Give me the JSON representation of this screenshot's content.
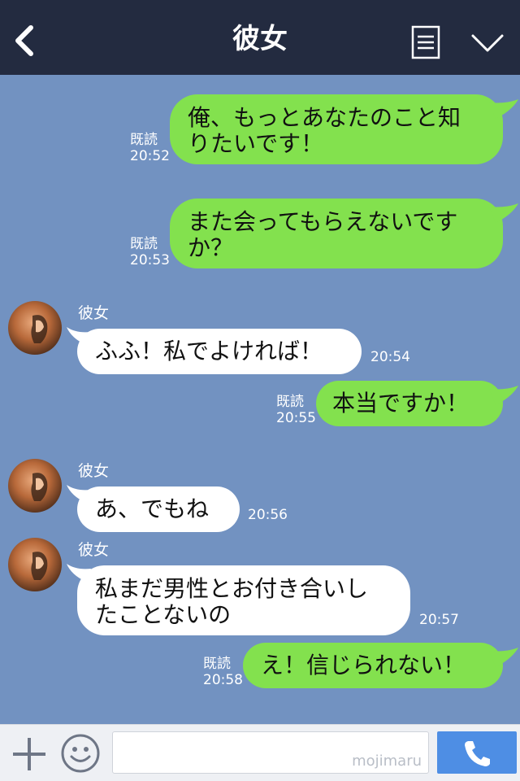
{
  "header": {
    "title": "彼女",
    "back_icon": "chevron-left-icon",
    "menu_icon": "menu-list-icon",
    "expand_icon": "chevron-down-icon"
  },
  "colors": {
    "header_bg": "#232b40",
    "chat_bg": "#7292c1",
    "outgoing_bubble": "#83e14e",
    "incoming_bubble": "#ffffff",
    "call_button": "#4e8ee4"
  },
  "messages": [
    {
      "side": "out",
      "lines": [
        "俺、もっとあなたのこと知",
        "りたいです！"
      ],
      "read": "既読",
      "time": "20:52"
    },
    {
      "side": "out",
      "lines": [
        "また会ってもらえないです",
        "か？"
      ],
      "read": "既読",
      "time": "20:53"
    },
    {
      "side": "in",
      "sender": "彼女",
      "lines": [
        "ふふ！私でよければ！"
      ],
      "time": "20:54"
    },
    {
      "side": "out",
      "lines": [
        "本当ですか！"
      ],
      "read": "既読",
      "time": "20:55"
    },
    {
      "side": "in",
      "sender": "彼女",
      "lines": [
        "あ、でもね"
      ],
      "time": "20:56"
    },
    {
      "side": "in",
      "sender": "彼女",
      "lines": [
        "私まだ男性とお付き合いし",
        "たことないの"
      ],
      "time": "20:57"
    },
    {
      "side": "out",
      "lines": [
        "え！信じられない！"
      ],
      "read": "既読",
      "time": "20:58"
    }
  ],
  "bottom_bar": {
    "plus_icon": "plus-icon",
    "sticker_icon": "smile-icon",
    "input_value": "",
    "watermark": "mojimaru",
    "call_icon": "phone-icon"
  }
}
